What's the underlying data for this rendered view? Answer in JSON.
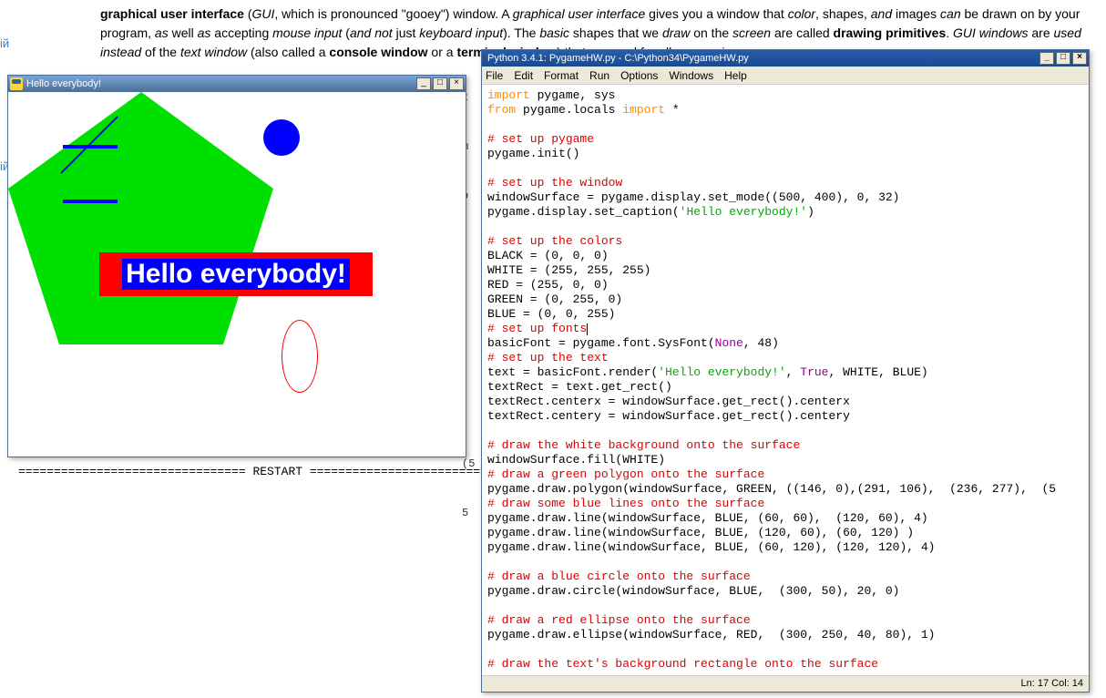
{
  "bg_page": {
    "para1_html": "<strong>graphical user interface</strong> (<em>GUI</em>, which is pronounced \"gooey\") window. A <em>graphical user interface</em> gives you a window that <em>color</em>, shapes, <em>and</em> images <em>can</em> be drawn on by your program, <em>as</em> well <em>as</em> accepting <em>mouse input</em> (<em>and not</em> just <em>keyboard input</em>). The <em>basic</em> shapes that we <em>draw</em> on the <em>screen</em> are called <strong>drawing primitives</strong>. <em>GUI windows</em> are <em>used instead</em> of the <em>text window</em> (also called a <strong>console window</strong> or a <strong>terminal window</strong>) that we used for all our previous games.",
    "sidelink1": "ій",
    "sidelink2": "ій",
    "restart": "================================ RESTART ================================",
    "frag1": "t",
    "frag2": "m",
    "frag3": "o",
    "frag4": "(5",
    "frag5": "5"
  },
  "pygame_window": {
    "title": "Hello everybody!",
    "text_overlay": "Hello everybody!",
    "minimize": "_",
    "maximize": "□",
    "close": "×"
  },
  "idle_window": {
    "title": "Python 3.4.1: PygameHW.py - C:\\Python34\\PygameHW.py",
    "menu": [
      "File",
      "Edit",
      "Format",
      "Run",
      "Options",
      "Windows",
      "Help"
    ],
    "minimize": "_",
    "maximize": "□",
    "close": "×",
    "status": "Ln: 17 Col: 14",
    "code": {
      "l01a": "import",
      "l01b": " pygame, sys",
      "l02a": "from",
      "l02b": " pygame.locals ",
      "l02c": "import",
      "l02d": " *",
      "l04": "# set up pygame",
      "l05": "pygame.init()",
      "l07": "# set up the window",
      "l08": "windowSurface = pygame.display.set_mode((500, 400), 0, 32)",
      "l09a": "pygame.display.set_caption(",
      "l09b": "'Hello everybody!'",
      "l09c": ")",
      "l11": "# set up the colors",
      "l12": "BLACK = (0, 0, 0)",
      "l13": "WHITE = (255, 255, 255)",
      "l14": "RED = (255, 0, 0)",
      "l15": "GREEN = (0, 255, 0)",
      "l16": "BLUE = (0, 0, 255)",
      "l17": "# set up fonts",
      "l18a": "basicFont = pygame.font.SysFont(",
      "l18b": "None",
      "l18c": ", 48)",
      "l19": "# set up the text",
      "l20a": "text = basicFont.render(",
      "l20b": "'Hello everybody!'",
      "l20c": ", ",
      "l20d": "True",
      "l20e": ", WHITE, BLUE)",
      "l21": "textRect = text.get_rect()",
      "l22": "textRect.centerx = windowSurface.get_rect().centerx",
      "l23": "textRect.centery = windowSurface.get_rect().centery",
      "l25": "# draw the white background onto the surface",
      "l26": "windowSurface.fill(WHITE)",
      "l27": "# draw a green polygon onto the surface",
      "l28": "pygame.draw.polygon(windowSurface, GREEN, ((146, 0),(291, 106),  (236, 277),  (5",
      "l29": "# draw some blue lines onto the surface",
      "l30": "pygame.draw.line(windowSurface, BLUE, (60, 60),  (120, 60), 4)",
      "l31": "pygame.draw.line(windowSurface, BLUE, (120, 60), (60, 120) )",
      "l32": "pygame.draw.line(windowSurface, BLUE, (60, 120), (120, 120), 4)",
      "l34": "# draw a blue circle onto the surface",
      "l35": "pygame.draw.circle(windowSurface, BLUE,  (300, 50), 20, 0)",
      "l37": "# draw a red ellipse onto the surface",
      "l38": "pygame.draw.ellipse(windowSurface, RED,  (300, 250, 40, 80), 1)",
      "l40": "# draw the text's background rectangle onto the surface"
    }
  }
}
